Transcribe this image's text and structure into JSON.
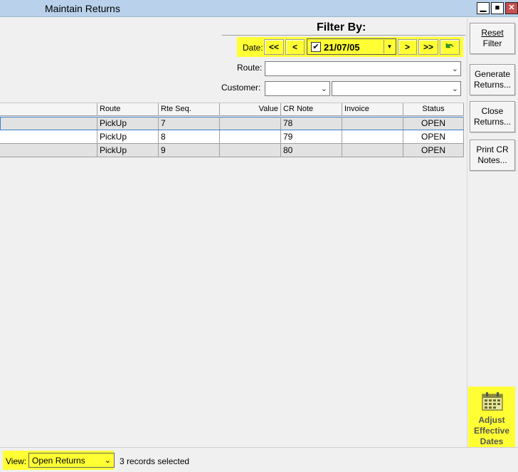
{
  "window": {
    "title": "Maintain Returns",
    "min_icon": "minimize-icon",
    "max_icon": "maximize-icon",
    "close_icon": "close-icon"
  },
  "filter": {
    "heading": "Filter By:",
    "date_label": "Date:",
    "nav_first": "<<",
    "nav_prev": "<",
    "date_value": "21/07/05",
    "date_checked": true,
    "nav_next": ">",
    "nav_last": ">>",
    "route_label": "Route:",
    "route_value": "",
    "customer_label": "Customer:",
    "customer_code_value": "",
    "customer_name_value": "",
    "highlight_color": "#ffff33"
  },
  "grid": {
    "columns": [
      "",
      "Route",
      "Rte Seq.",
      "Value",
      "CR Note",
      "Invoice",
      "Status"
    ],
    "rows": [
      {
        "c0": "",
        "route": "PickUp",
        "seq": "7",
        "value": "",
        "cr_note": "78",
        "invoice": "",
        "status": "OPEN"
      },
      {
        "c0": "",
        "route": "PickUp",
        "seq": "8",
        "value": "",
        "cr_note": "79",
        "invoice": "",
        "status": "OPEN"
      },
      {
        "c0": "",
        "route": "PickUp",
        "seq": "9",
        "value": "",
        "cr_note": "80",
        "invoice": "",
        "status": "OPEN"
      }
    ]
  },
  "side": {
    "reset_line1": "Reset",
    "reset_line2": "Filter",
    "generate_line1": "Generate",
    "generate_line2": "Returns...",
    "close_line1": "Close",
    "close_line2": "Returns...",
    "print_line1": "Print CR",
    "print_line2": "Notes...",
    "adjust_line1": "Adjust",
    "adjust_line2": "Effective",
    "adjust_line3": "Dates",
    "adjust_icon": "calendar-icon"
  },
  "status": {
    "view_label": "View:",
    "view_value": "Open Returns",
    "records": "3 records selected"
  }
}
